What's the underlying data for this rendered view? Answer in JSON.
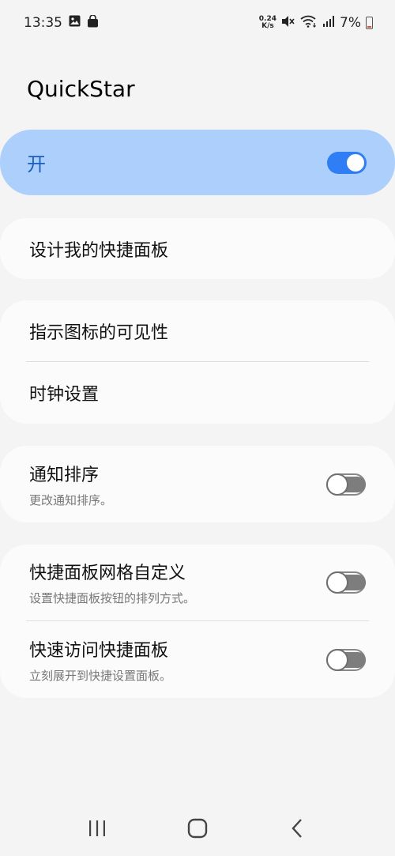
{
  "status_bar": {
    "time": "13:35",
    "net_speed_value": "0.24",
    "net_speed_unit": "K/s",
    "battery": "7%",
    "icons": [
      "image-icon",
      "shopping-bag-icon",
      "mute-icon",
      "wifi-icon",
      "signal-icon",
      "battery-icon"
    ]
  },
  "header": {
    "title": "QuickStar"
  },
  "master_switch": {
    "label": "开",
    "enabled": true
  },
  "sections": {
    "design_panel": {
      "title": "设计我的快捷面板"
    },
    "indicator_visibility": {
      "title": "指示图标的可见性"
    },
    "clock_settings": {
      "title": "时钟设置"
    },
    "notification_order": {
      "title": "通知排序",
      "subtitle": "更改通知排序。",
      "enabled": false
    },
    "panel_grid": {
      "title": "快捷面板网格自定义",
      "subtitle": "设置快捷面板按钮的排列方式。",
      "enabled": false
    },
    "quick_access": {
      "title": "快速访问快捷面板",
      "subtitle": "立刻展开到快捷设置面板。",
      "enabled": false
    }
  },
  "nav": {
    "icons": [
      "recent-apps-icon",
      "home-icon",
      "back-icon"
    ]
  },
  "colors": {
    "accent": "#2f7ef5",
    "master_bg": "#acd0fb"
  }
}
